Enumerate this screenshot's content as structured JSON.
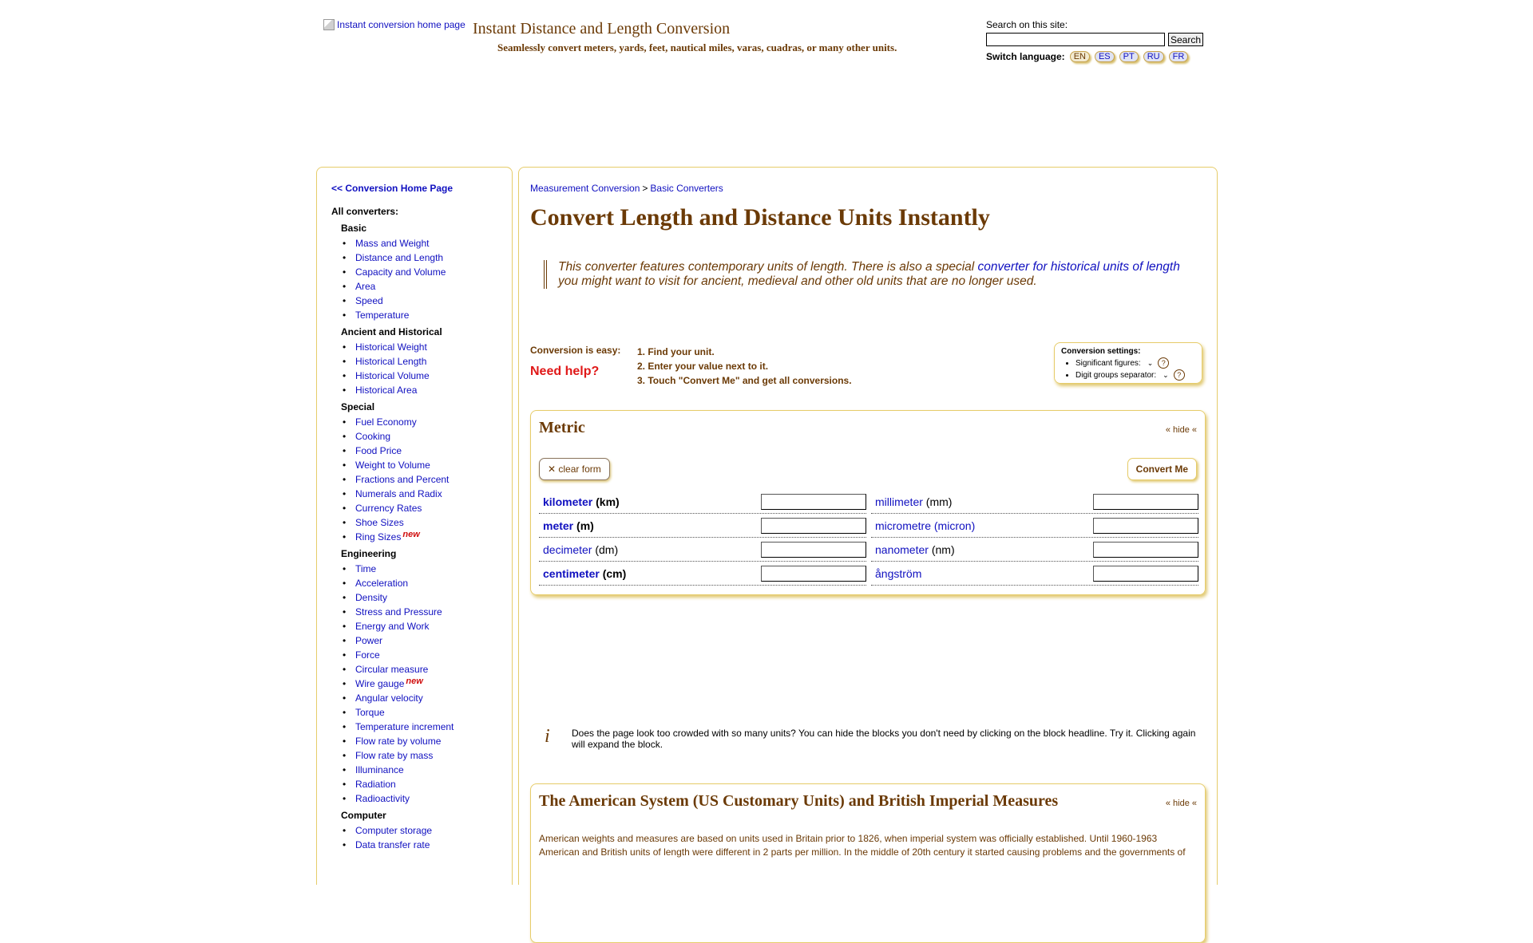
{
  "header": {
    "logo_alt": "Instant conversion home page",
    "site_title": "Instant Distance and Length Conversion",
    "site_subtitle": "Seamlessly convert meters, yards, feet, nautical miles, varas, cuadras, or many other units.",
    "search_label": "Search on this site:",
    "search_value": "",
    "search_button": "Search",
    "switch_language_label": "Switch language:",
    "languages": [
      "EN",
      "ES",
      "PT",
      "RU",
      "FR"
    ],
    "active_language": "EN"
  },
  "sidebar": {
    "home_link": "<< Conversion Home Page",
    "all_converters_label": "All converters:",
    "new_badge": "new",
    "groups": [
      {
        "title": "Basic",
        "items": [
          {
            "label": "Mass and Weight"
          },
          {
            "label": "Distance and Length"
          },
          {
            "label": "Capacity and Volume"
          },
          {
            "label": "Area"
          },
          {
            "label": "Speed"
          },
          {
            "label": "Temperature"
          }
        ]
      },
      {
        "title": "Ancient and Historical",
        "items": [
          {
            "label": "Historical Weight"
          },
          {
            "label": "Historical Length"
          },
          {
            "label": "Historical Volume"
          },
          {
            "label": "Historical Area"
          }
        ]
      },
      {
        "title": "Special",
        "items": [
          {
            "label": "Fuel Economy"
          },
          {
            "label": "Cooking"
          },
          {
            "label": "Food Price"
          },
          {
            "label": "Weight to Volume"
          },
          {
            "label": "Fractions and Percent"
          },
          {
            "label": "Numerals and Radix"
          },
          {
            "label": "Currency Rates"
          },
          {
            "label": "Shoe Sizes"
          },
          {
            "label": "Ring Sizes",
            "new": true
          }
        ]
      },
      {
        "title": "Engineering",
        "items": [
          {
            "label": "Time"
          },
          {
            "label": "Acceleration"
          },
          {
            "label": "Density"
          },
          {
            "label": "Stress and Pressure"
          },
          {
            "label": "Energy and Work"
          },
          {
            "label": "Power"
          },
          {
            "label": "Force"
          },
          {
            "label": "Circular measure"
          },
          {
            "label": "Wire gauge",
            "new": true
          },
          {
            "label": "Angular velocity"
          },
          {
            "label": "Torque"
          },
          {
            "label": "Temperature increment"
          },
          {
            "label": "Flow rate by volume"
          },
          {
            "label": "Flow rate by mass"
          },
          {
            "label": "Illuminance"
          },
          {
            "label": "Radiation"
          },
          {
            "label": "Radioactivity"
          }
        ]
      },
      {
        "title": "Computer",
        "items": [
          {
            "label": "Computer storage"
          },
          {
            "label": "Data transfer rate"
          }
        ]
      }
    ]
  },
  "main": {
    "breadcrumb": [
      "Measurement Conversion",
      "Basic Converters"
    ],
    "breadcrumb_sep": ">",
    "page_title": "Convert Length and Distance Units Instantly",
    "intro_before": "This converter features contemporary units of length. There is also a special ",
    "intro_link": "converter for historical units of length",
    "intro_after": " you might want to visit for ancient, medieval and other old units that are no longer used.",
    "easy_label": "Conversion is easy:",
    "need_help": "Need help?",
    "steps": [
      "1. Find your unit.",
      "2. Enter your value next to it.",
      "3. Touch \"Convert Me\" and get all conversions."
    ],
    "settings": {
      "title": "Conversion settings:",
      "significant_figures": "Significant figures:",
      "digit_groups": "Digit groups separator:",
      "help_icon_text": "?"
    },
    "metric_block": {
      "title": "Metric",
      "hide": "« hide «",
      "clear_form": "✕ clear form",
      "convert_me": "Convert Me",
      "units": [
        {
          "name": "kilometer",
          "abbr": "(km)",
          "bold": true,
          "value": ""
        },
        {
          "name": "millimeter",
          "abbr": "(mm)",
          "bold": false,
          "value": ""
        },
        {
          "name": "meter",
          "abbr": "(m)",
          "bold": true,
          "value": ""
        },
        {
          "name": "micrometre (micron)",
          "abbr": "",
          "bold": false,
          "value": ""
        },
        {
          "name": "decimeter",
          "abbr": "(dm)",
          "bold": false,
          "value": ""
        },
        {
          "name": "nanometer",
          "abbr": "(nm)",
          "bold": false,
          "value": ""
        },
        {
          "name": "centimeter",
          "abbr": "(cm)",
          "bold": true,
          "value": ""
        },
        {
          "name": "ångström",
          "abbr": "",
          "bold": false,
          "value": ""
        }
      ]
    },
    "info": {
      "icon": "i",
      "text": "Does the page look too crowded with so many units? You can hide the blocks you don't need by clicking on the block headline. Try it. Clicking again will expand the block."
    },
    "us_block": {
      "title": "The American System (US Customary Units) and British Imperial Measures",
      "hide": "« hide «",
      "text": "American weights and measures are based on units used in Britain prior to 1826, when imperial system was officially established. Until 1960-1963 American and British units of length were different in 2 parts per million. In the middle of 20th century it started causing problems and the governments of"
    }
  },
  "colors": {
    "accent_brown": "#6b3a06",
    "link_blue": "#1010c0",
    "panel_border": "#e6cc6a",
    "help_red": "#e01818"
  }
}
